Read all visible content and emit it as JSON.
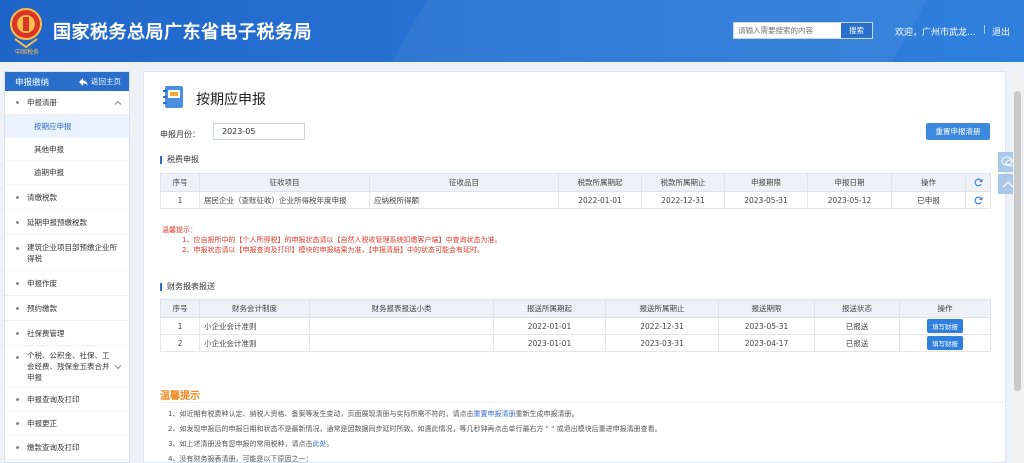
{
  "header": {
    "title": "国家税务总局广东省电子税务局",
    "emblem_text": "中国税务",
    "search_placeholder": "请输入需要搜索的内容",
    "search_button": "搜索",
    "welcome": "欢迎，广州市武龙...",
    "separator": "|",
    "logout": "退出"
  },
  "sidebar": {
    "head": "申报缴纳",
    "home": "返回主页",
    "group_expanded": "申报清册",
    "sub_items": [
      "按期应申报",
      "其他申报",
      "逾期申报"
    ],
    "items": [
      "清缴税款",
      "延期申报预缴税款",
      "建筑企业项目部预缴企业所得税",
      "申报作废",
      "预约缴款",
      "社保费管理",
      "个税、公积金、社保、工会经费、残保金五表合并申报",
      "申报查询及打印",
      "申报更正",
      "缴款查询及打印"
    ]
  },
  "main": {
    "title": "按期应申报",
    "month_label": "申报月份：",
    "month_value": "2023-05",
    "reset_button": "重置申报清册",
    "tax_section": "税费申报",
    "tax_headers": [
      "序号",
      "征收项目",
      "征收品目",
      "税款所属期起",
      "税款所属期止",
      "申报期限",
      "申报日期",
      "操作"
    ],
    "tax_rows": [
      [
        "1",
        "居民企业（查账征收）企业所得税年度申报",
        "应纳税所得额",
        "2022-01-01",
        "2022-12-31",
        "2023-05-31",
        "2023-05-12",
        "已申报"
      ]
    ],
    "warn_title": "温馨提示：",
    "warn_lines": [
      "1、应自报所中的【个人所得税】的申报状态请以【自然人税收管理系统扣缴客户端】中查询状态为准。",
      "2、申报状态请以【申报查询及打印】模块的申报结果为准，【申报清册】中的状态可能会有延时。"
    ],
    "fin_section": "财务报表报送",
    "fin_headers": [
      "序号",
      "财务会计制度",
      "财务报表报送小类",
      "报送所属期起",
      "报送所属期止",
      "报送期限",
      "报送状态",
      "操作"
    ],
    "fin_rows": [
      [
        "1",
        "小企业会计准则",
        "",
        "2022-01-01",
        "2022-12-31",
        "2023-05-31",
        "已报送",
        "填写财报"
      ],
      [
        "2",
        "小企业会计准则",
        "",
        "2023-01-01",
        "2023-03-31",
        "2023-04-17",
        "已报送",
        "填写财报"
      ]
    ],
    "tips_title": "温馨提示",
    "tips": {
      "t1_a": "1、如近期有税费种认定、纳税人资格、备案等发生变动，页面展现清册与实际所需不符的，请点击",
      "t1_link": "重置申报清册",
      "t1_b": "重新生成申报清册。",
      "t2": "2、如发现申报后的申报日期和状态不是最新情况，通常是因数据同步延时所致。如遇此情况，等几秒钟再点击单行最右方 \" \" 或退出模块后重进申报清册查看。",
      "t3_a": "3、如上述清册没有您申报的常用税种，请点击",
      "t3_link": "此处",
      "t3_b": "。",
      "t4": "4、没有财务报表清册，可能是以下原因之一："
    }
  },
  "colors": {
    "header": "#2a6fcb",
    "accent": "#2f7fdc",
    "warn": "#e23b2e",
    "tips": "#f08a24"
  }
}
